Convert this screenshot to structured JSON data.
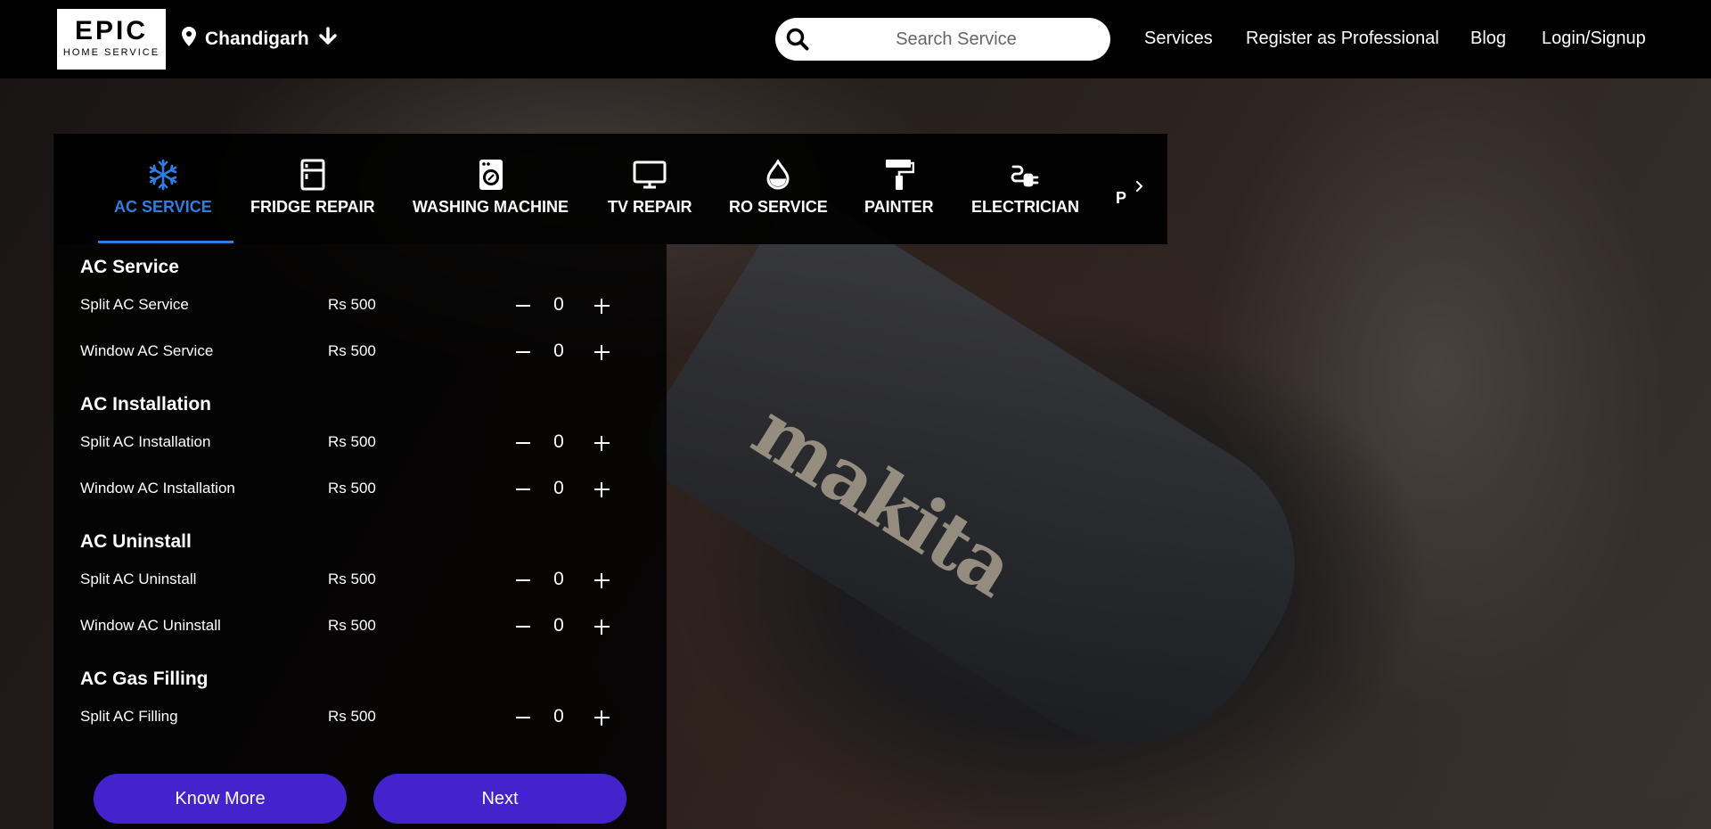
{
  "header": {
    "logo": {
      "main": "EPIC",
      "sub": "HOME SERVICE"
    },
    "location": "Chandigarh",
    "search_placeholder": "Search Service",
    "nav": [
      "Services",
      "Register as Professional",
      "Blog",
      "Login/Signup"
    ]
  },
  "categories": [
    {
      "label": "AC SERVICE",
      "icon": "snowflake-icon",
      "active": true
    },
    {
      "label": "FRIDGE REPAIR",
      "icon": "fridge-icon",
      "active": false
    },
    {
      "label": "WASHING MACHINE",
      "icon": "washing-machine-icon",
      "active": false
    },
    {
      "label": "TV REPAIR",
      "icon": "tv-icon",
      "active": false
    },
    {
      "label": "RO SERVICE",
      "icon": "water-drop-icon",
      "active": false
    },
    {
      "label": "PAINTER",
      "icon": "paint-roller-icon",
      "active": false
    },
    {
      "label": "ELECTRICIAN",
      "icon": "plug-icon",
      "active": false
    },
    {
      "label": "P",
      "icon": "",
      "active": false
    }
  ],
  "sections": [
    {
      "title": "AC Service",
      "items": [
        {
          "name": "Split AC Service",
          "price": "Rs 500",
          "qty": "0"
        },
        {
          "name": "Window AC Service",
          "price": "Rs 500",
          "qty": "0"
        }
      ]
    },
    {
      "title": "AC Installation",
      "items": [
        {
          "name": "Split AC Installation",
          "price": "Rs 500",
          "qty": "0"
        },
        {
          "name": "Window AC Installation",
          "price": "Rs 500",
          "qty": "0"
        }
      ]
    },
    {
      "title": "AC Uninstall",
      "items": [
        {
          "name": "Split AC Uninstall",
          "price": "Rs 500",
          "qty": "0"
        },
        {
          "name": "Window AC Uninstall",
          "price": "Rs 500",
          "qty": "0"
        }
      ]
    },
    {
      "title": "AC Gas Filling",
      "items": [
        {
          "name": "Split AC Filling",
          "price": "Rs 500",
          "qty": "0"
        }
      ]
    }
  ],
  "buttons": {
    "know_more": "Know More",
    "next": "Next"
  },
  "colors": {
    "accent": "#2f7de1",
    "button": "#4422cc"
  },
  "photo_logo": "makita"
}
